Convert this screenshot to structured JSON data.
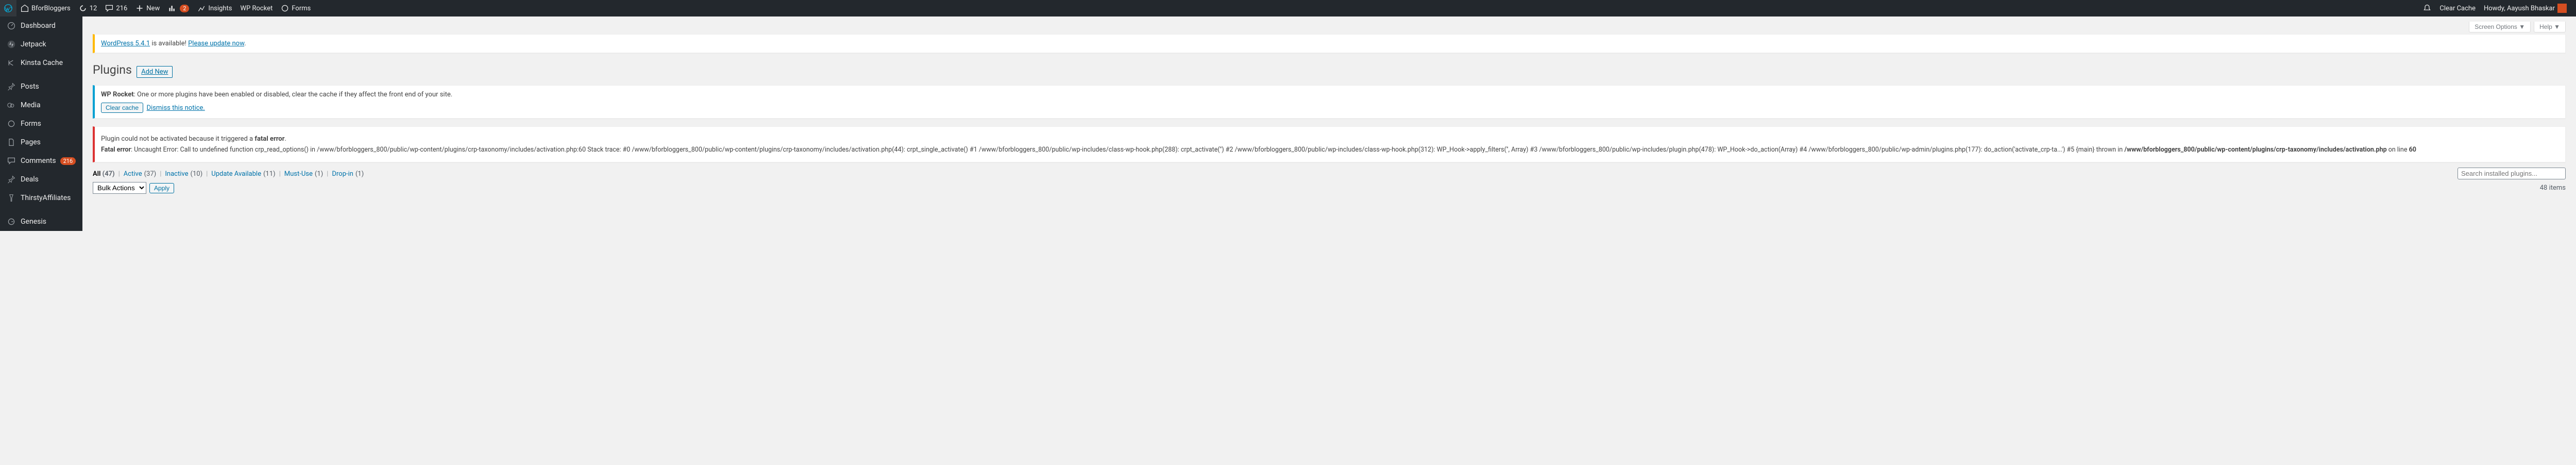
{
  "adminbar": {
    "site_name": "BforBloggers",
    "updates": "12",
    "comments": "216",
    "new": "New",
    "ab_count": "2",
    "insights": "Insights",
    "wp_rocket": "WP Rocket",
    "forms": "Forms",
    "clear_cache": "Clear Cache",
    "howdy": "Howdy, Aayush Bhaskar"
  },
  "sidebar": {
    "items": [
      {
        "label": "Dashboard"
      },
      {
        "label": "Jetpack"
      },
      {
        "label": "Kinsta Cache"
      },
      {
        "label": "Posts"
      },
      {
        "label": "Media"
      },
      {
        "label": "Forms"
      },
      {
        "label": "Pages"
      },
      {
        "label": "Comments",
        "count": "216"
      },
      {
        "label": "Deals"
      },
      {
        "label": "ThirstyAffiliates"
      },
      {
        "label": "Genesis"
      }
    ]
  },
  "screen": {
    "options": "Screen Options ▼",
    "help": "Help ▼"
  },
  "update_notice": {
    "pre": "WordPress 5.4.1",
    "mid": " is available! ",
    "link": "Please update now"
  },
  "page": {
    "title": "Plugins",
    "add_new": "Add New"
  },
  "rocket_notice": {
    "bold": "WP Rocket",
    "text": ": One or more plugins have been enabled or disabled, clear the cache if they affect the front end of your site.",
    "clear": "Clear cache",
    "dismiss": "Dismiss this notice."
  },
  "error_notice": {
    "line1_pre": "Plugin could not be activated because it triggered a ",
    "line1_bold": "fatal error",
    "fatal": "Fatal error",
    "body": ": Uncaught Error: Call to undefined function crp_read_options() in /www/bforbloggers_800/public/wp-content/plugins/crp-taxonomy/includes/activation.php:60 Stack trace: #0 /www/bforbloggers_800/public/wp-content/plugins/crp-taxonomy/includes/activation.php(44): crpt_single_activate() #1 /www/bforbloggers_800/public/wp-includes/class-wp-hook.php(288): crpt_activate('') #2 /www/bforbloggers_800/public/wp-includes/class-wp-hook.php(312): WP_Hook->apply_filters('', Array) #3 /www/bforbloggers_800/public/wp-includes/plugin.php(478): WP_Hook->do_action(Array) #4 /www/bforbloggers_800/public/wp-admin/plugins.php(177): do_action('activate_crp-ta...') #5 {main} thrown in ",
    "path": "/www/bforbloggers_800/public/wp-content/plugins/crp-taxonomy/includes/activation.php",
    "online": " on line ",
    "linenum": "60"
  },
  "filters": {
    "all": "All",
    "all_c": "(47)",
    "active": "Active",
    "active_c": "(37)",
    "inactive": "Inactive",
    "inactive_c": "(10)",
    "update": "Update Available",
    "update_c": "(11)",
    "mustuse": "Must-Use",
    "mustuse_c": "(1)",
    "dropin": "Drop-in",
    "dropin_c": "(1)"
  },
  "search_placeholder": "Search installed plugins...",
  "bulk": {
    "label": "Bulk Actions",
    "apply": "Apply"
  },
  "items_count": "48 items"
}
